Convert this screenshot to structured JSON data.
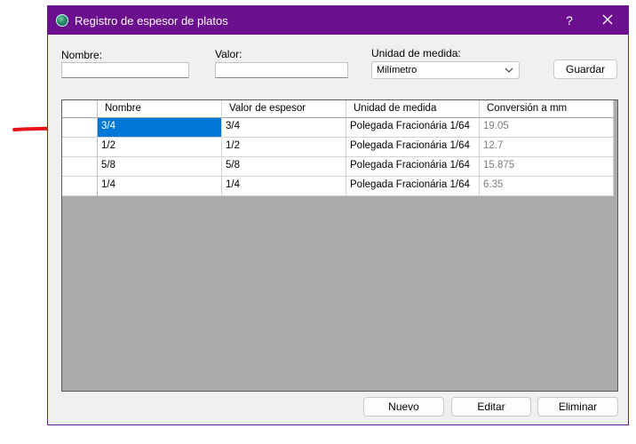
{
  "window": {
    "title": "Registro de espesor de platos",
    "help_glyph": "?",
    "accent_color": "#6c0f8e"
  },
  "form": {
    "nombre_label": "Nombre:",
    "nombre_value": "",
    "valor_label": "Valor:",
    "valor_value": "",
    "unidad_label": "Unidad de medida:",
    "unidad_selected": "Milímetro",
    "guardar_label": "Guardar"
  },
  "table": {
    "columns": [
      "Nombre",
      "Valor de espesor",
      "Unidad de medida",
      "Conversión a mm"
    ],
    "rows": [
      [
        "3/4",
        "3/4",
        "Polegada Fracionária 1/64",
        "19.05"
      ],
      [
        "1/2",
        "1/2",
        "Polegada Fracionária 1/64",
        "12.7"
      ],
      [
        "5/8",
        "5/8",
        "Polegada Fracionária 1/64",
        "15.875"
      ],
      [
        "1/4",
        "1/4",
        "Polegada Fracionária 1/64",
        "6.35"
      ]
    ],
    "selected_row": 0,
    "selection_color": "#0078d7"
  },
  "actions": {
    "nuevo_label": "Nuevo",
    "editar_label": "Editar",
    "eliminar_label": "Eliminar"
  },
  "annotation": {
    "arrow_color": "#e8141a",
    "arrow_icon": "red-pointer-arrow"
  }
}
